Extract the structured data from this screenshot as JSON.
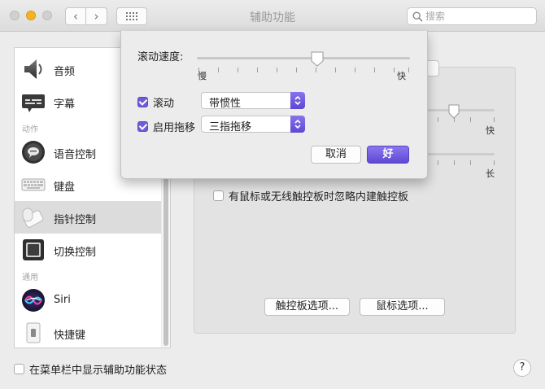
{
  "window": {
    "title": "辅助功能",
    "search_placeholder": "搜索",
    "back_glyph": "‹",
    "forward_glyph": "›"
  },
  "sidebar": {
    "items": [
      {
        "label": "音频",
        "icon": "speaker-icon"
      },
      {
        "label": "字幕",
        "icon": "captions-icon"
      },
      {
        "category": "动作"
      },
      {
        "label": "语音控制",
        "icon": "voice-control-icon"
      },
      {
        "label": "键盘",
        "icon": "keyboard-icon"
      },
      {
        "label": "指针控制",
        "icon": "pointer-control-icon",
        "selected": true
      },
      {
        "label": "切换控制",
        "icon": "switch-control-icon"
      },
      {
        "category": "通用"
      },
      {
        "label": "Siri",
        "icon": "siri-icon"
      },
      {
        "label": "快捷键",
        "icon": "shortcut-icon"
      }
    ]
  },
  "main": {
    "tab_partial": "​",
    "slider1_max": "快",
    "slider2_max": "长",
    "ignore_builtin_checkbox": {
      "label": "有鼠标或无线触控板时忽略内建触控板",
      "checked": false
    },
    "trackpad_options_button": "触控板选项...",
    "mouse_options_button": "鼠标选项..."
  },
  "sheet": {
    "scroll_speed_label": "滚动速度:",
    "scroll_speed_min": "慢",
    "scroll_speed_max": "快",
    "scroll_speed_value": 0.6,
    "scrolling": {
      "label": "滚动",
      "checked": true,
      "selected": "带惯性"
    },
    "dragging": {
      "label": "启用拖移",
      "checked": true,
      "selected": "三指拖移"
    },
    "cancel_button": "取消",
    "ok_button": "好"
  },
  "footer": {
    "show_status_checkbox": {
      "label": "在菜单栏中显示辅助功能状态",
      "checked": false
    },
    "help_button": "?"
  },
  "colors": {
    "accent": "#6e5cd6",
    "window_bg": "#ececec"
  }
}
